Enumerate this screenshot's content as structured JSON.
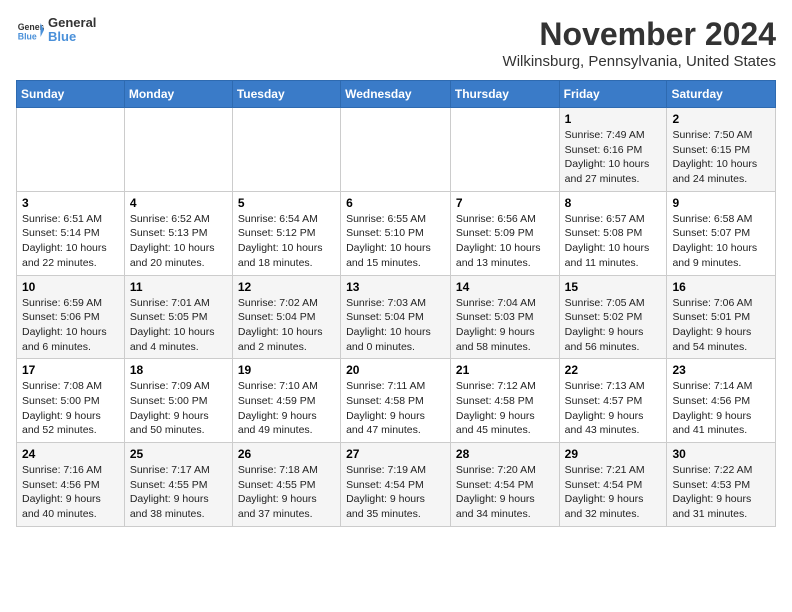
{
  "header": {
    "logo_general": "General",
    "logo_blue": "Blue",
    "month_title": "November 2024",
    "location": "Wilkinsburg, Pennsylvania, United States"
  },
  "days_of_week": [
    "Sunday",
    "Monday",
    "Tuesday",
    "Wednesday",
    "Thursday",
    "Friday",
    "Saturday"
  ],
  "weeks": [
    [
      {
        "num": "",
        "info": ""
      },
      {
        "num": "",
        "info": ""
      },
      {
        "num": "",
        "info": ""
      },
      {
        "num": "",
        "info": ""
      },
      {
        "num": "",
        "info": ""
      },
      {
        "num": "1",
        "info": "Sunrise: 7:49 AM\nSunset: 6:16 PM\nDaylight: 10 hours and 27 minutes."
      },
      {
        "num": "2",
        "info": "Sunrise: 7:50 AM\nSunset: 6:15 PM\nDaylight: 10 hours and 24 minutes."
      }
    ],
    [
      {
        "num": "3",
        "info": "Sunrise: 6:51 AM\nSunset: 5:14 PM\nDaylight: 10 hours and 22 minutes."
      },
      {
        "num": "4",
        "info": "Sunrise: 6:52 AM\nSunset: 5:13 PM\nDaylight: 10 hours and 20 minutes."
      },
      {
        "num": "5",
        "info": "Sunrise: 6:54 AM\nSunset: 5:12 PM\nDaylight: 10 hours and 18 minutes."
      },
      {
        "num": "6",
        "info": "Sunrise: 6:55 AM\nSunset: 5:10 PM\nDaylight: 10 hours and 15 minutes."
      },
      {
        "num": "7",
        "info": "Sunrise: 6:56 AM\nSunset: 5:09 PM\nDaylight: 10 hours and 13 minutes."
      },
      {
        "num": "8",
        "info": "Sunrise: 6:57 AM\nSunset: 5:08 PM\nDaylight: 10 hours and 11 minutes."
      },
      {
        "num": "9",
        "info": "Sunrise: 6:58 AM\nSunset: 5:07 PM\nDaylight: 10 hours and 9 minutes."
      }
    ],
    [
      {
        "num": "10",
        "info": "Sunrise: 6:59 AM\nSunset: 5:06 PM\nDaylight: 10 hours and 6 minutes."
      },
      {
        "num": "11",
        "info": "Sunrise: 7:01 AM\nSunset: 5:05 PM\nDaylight: 10 hours and 4 minutes."
      },
      {
        "num": "12",
        "info": "Sunrise: 7:02 AM\nSunset: 5:04 PM\nDaylight: 10 hours and 2 minutes."
      },
      {
        "num": "13",
        "info": "Sunrise: 7:03 AM\nSunset: 5:04 PM\nDaylight: 10 hours and 0 minutes."
      },
      {
        "num": "14",
        "info": "Sunrise: 7:04 AM\nSunset: 5:03 PM\nDaylight: 9 hours and 58 minutes."
      },
      {
        "num": "15",
        "info": "Sunrise: 7:05 AM\nSunset: 5:02 PM\nDaylight: 9 hours and 56 minutes."
      },
      {
        "num": "16",
        "info": "Sunrise: 7:06 AM\nSunset: 5:01 PM\nDaylight: 9 hours and 54 minutes."
      }
    ],
    [
      {
        "num": "17",
        "info": "Sunrise: 7:08 AM\nSunset: 5:00 PM\nDaylight: 9 hours and 52 minutes."
      },
      {
        "num": "18",
        "info": "Sunrise: 7:09 AM\nSunset: 5:00 PM\nDaylight: 9 hours and 50 minutes."
      },
      {
        "num": "19",
        "info": "Sunrise: 7:10 AM\nSunset: 4:59 PM\nDaylight: 9 hours and 49 minutes."
      },
      {
        "num": "20",
        "info": "Sunrise: 7:11 AM\nSunset: 4:58 PM\nDaylight: 9 hours and 47 minutes."
      },
      {
        "num": "21",
        "info": "Sunrise: 7:12 AM\nSunset: 4:58 PM\nDaylight: 9 hours and 45 minutes."
      },
      {
        "num": "22",
        "info": "Sunrise: 7:13 AM\nSunset: 4:57 PM\nDaylight: 9 hours and 43 minutes."
      },
      {
        "num": "23",
        "info": "Sunrise: 7:14 AM\nSunset: 4:56 PM\nDaylight: 9 hours and 41 minutes."
      }
    ],
    [
      {
        "num": "24",
        "info": "Sunrise: 7:16 AM\nSunset: 4:56 PM\nDaylight: 9 hours and 40 minutes."
      },
      {
        "num": "25",
        "info": "Sunrise: 7:17 AM\nSunset: 4:55 PM\nDaylight: 9 hours and 38 minutes."
      },
      {
        "num": "26",
        "info": "Sunrise: 7:18 AM\nSunset: 4:55 PM\nDaylight: 9 hours and 37 minutes."
      },
      {
        "num": "27",
        "info": "Sunrise: 7:19 AM\nSunset: 4:54 PM\nDaylight: 9 hours and 35 minutes."
      },
      {
        "num": "28",
        "info": "Sunrise: 7:20 AM\nSunset: 4:54 PM\nDaylight: 9 hours and 34 minutes."
      },
      {
        "num": "29",
        "info": "Sunrise: 7:21 AM\nSunset: 4:54 PM\nDaylight: 9 hours and 32 minutes."
      },
      {
        "num": "30",
        "info": "Sunrise: 7:22 AM\nSunset: 4:53 PM\nDaylight: 9 hours and 31 minutes."
      }
    ]
  ]
}
